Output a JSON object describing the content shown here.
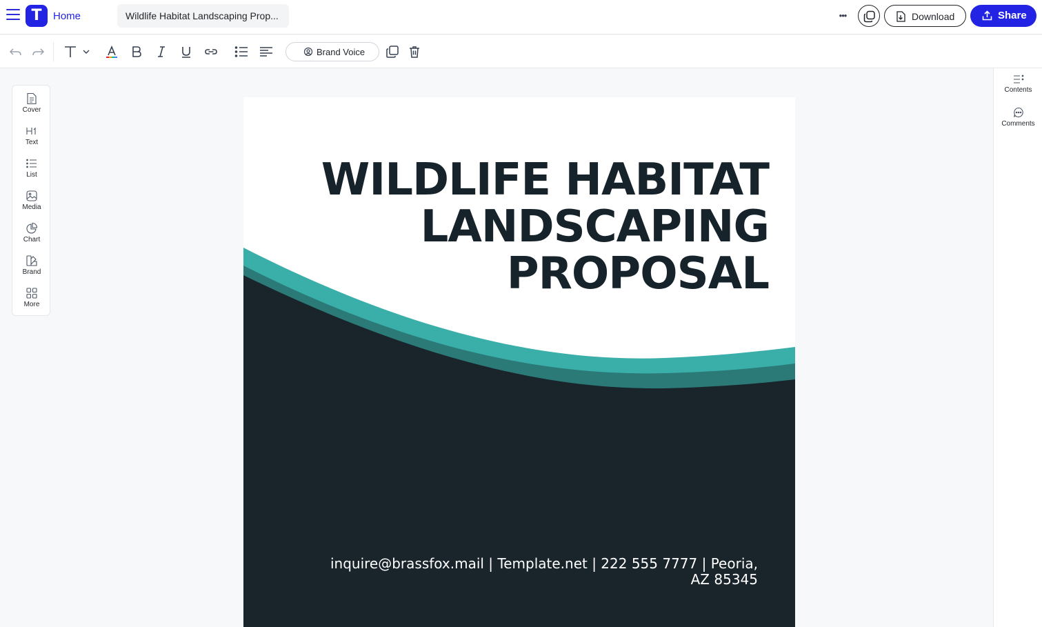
{
  "header": {
    "home_label": "Home",
    "logo_letter": "T",
    "doc_title": "Wildlife Habitat Landscaping Prop...",
    "more_icon": "•••",
    "download_label": "Download",
    "share_label": "Share",
    "accent_color": "#2323e3"
  },
  "toolbar": {
    "brand_voice_label": "Brand Voice"
  },
  "sidebar": {
    "items": [
      {
        "label": "Cover",
        "icon": "cover-icon"
      },
      {
        "label": "Text",
        "icon": "heading-icon"
      },
      {
        "label": "List",
        "icon": "list-icon"
      },
      {
        "label": "Media",
        "icon": "image-icon"
      },
      {
        "label": "Chart",
        "icon": "chart-icon"
      },
      {
        "label": "Brand",
        "icon": "brand-icon"
      },
      {
        "label": "More",
        "icon": "grid-icon"
      }
    ]
  },
  "right_panel": {
    "items": [
      {
        "label": "Contents",
        "icon": "contents-icon"
      },
      {
        "label": "Comments",
        "icon": "comments-icon"
      }
    ]
  },
  "document": {
    "title_lines": [
      "WILDLIFE HABITAT",
      "LANDSCAPING",
      "PROPOSAL"
    ],
    "contact_line_1": "inquire@brassfox.mail | Template.net | 222 555 7777 | Peoria,",
    "contact_line_2": "AZ 85345",
    "colors": {
      "dark": "#19242b",
      "teal": "#3aafa9",
      "teal_dark": "#2b7a78"
    }
  }
}
